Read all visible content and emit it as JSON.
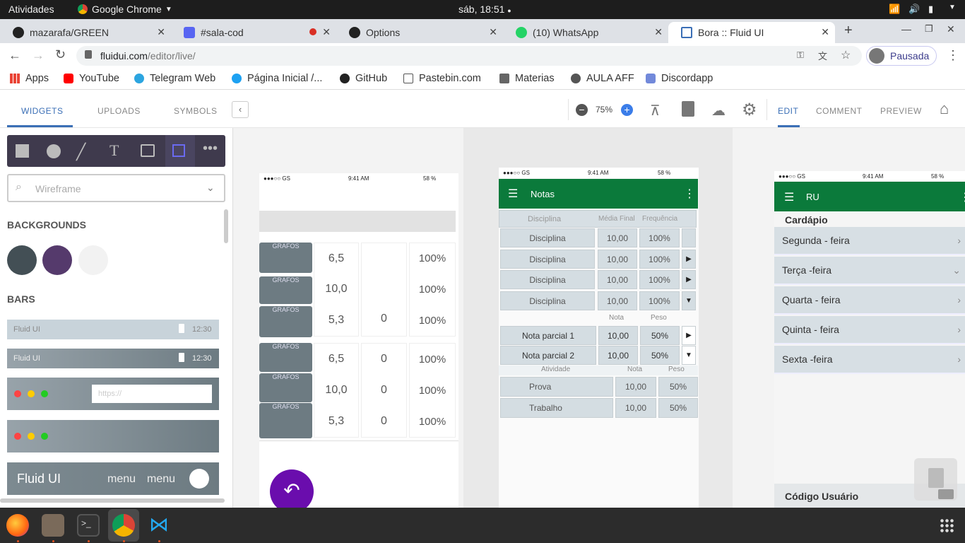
{
  "os": {
    "activities": "Atividades",
    "app_menu": "Google Chrome",
    "clock": "sáb, 18:51"
  },
  "browser": {
    "tabs": [
      {
        "title": "mazarafa/GREEN"
      },
      {
        "title": "#sala-cod"
      },
      {
        "title": "Options"
      },
      {
        "title": "(10) WhatsApp"
      },
      {
        "title": "Bora :: Fluid UI"
      }
    ],
    "new_tab": "+",
    "url_host": "fluidui.com",
    "url_path": "/editor/live/",
    "profile_label": "Pausada",
    "bookmarks": [
      "Apps",
      "YouTube",
      "Telegram Web",
      "Página Inicial /...",
      "GitHub",
      "Pastebin.com",
      "Materias",
      "AULA AFF",
      "Discordapp"
    ]
  },
  "app": {
    "left_tabs": [
      "WIDGETS",
      "UPLOADS",
      "SYMBOLS"
    ],
    "zoom": "75%",
    "mode_tabs": [
      "EDIT",
      "COMMENT",
      "PREVIEW"
    ],
    "search_placeholder": "Wireframe",
    "section_backgrounds": "BACKGROUNDS",
    "section_bars": "BARS",
    "bar1_label": "Fluid UI",
    "bar1_time": "12:30",
    "bar2_label": "Fluid UI",
    "bar2_time": "12:30",
    "url_placeholder": "https://",
    "fluid_title": "Fluid UI",
    "fluid_menu1": "menu",
    "fluid_menu2": "menu",
    "colors": {
      "swatch1": "#434f55",
      "swatch2": "#553a6c",
      "swatch3": "#f2f2f2",
      "accent": "#3b6fb6",
      "green": "#0b7a3b",
      "purple": "#6a0dad"
    }
  },
  "phone1": {
    "status": {
      "carrier": "●●●○○ GS",
      "time": "9:41 AM",
      "battery": "58 %"
    },
    "btn_label": "GRAFOS",
    "grid1": {
      "v1": "6,5",
      "v2": "10,0",
      "v3": "5,3",
      "z": "0",
      "p1": "100%",
      "p2": "100%",
      "p3": "100%"
    },
    "grid2": {
      "v1": "6,5",
      "v2": "10,0",
      "v3": "5,3",
      "z1": "0",
      "z2": "0",
      "z3": "0",
      "p1": "100%",
      "p2": "100%",
      "p3": "100%"
    }
  },
  "phone2": {
    "status": {
      "carrier": "●●●○○ GS",
      "time": "9:41 AM",
      "battery": "58 %"
    },
    "title": "Notas",
    "head": {
      "col1": "Disciplina",
      "col2": "Média Final",
      "col3": "Frequência"
    },
    "rows": [
      {
        "name": "Disciplina",
        "grade": "10,00",
        "freq": "100%"
      },
      {
        "name": "Disciplina",
        "grade": "10,00",
        "freq": "100%"
      },
      {
        "name": "Disciplina",
        "grade": "10,00",
        "freq": "100%"
      },
      {
        "name": "Disciplina",
        "grade": "10,00",
        "freq": "100%"
      }
    ],
    "sub_head": {
      "nota": "Nota",
      "peso": "Peso"
    },
    "partials": [
      {
        "name": "Nota parcial 1",
        "grade": "10,00",
        "weight": "50%"
      },
      {
        "name": "Nota parcial 2",
        "grade": "10,00",
        "weight": "50%"
      }
    ],
    "act_head": {
      "atividade": "Atividade",
      "nota": "Nota",
      "peso": "Peso"
    },
    "activities": [
      {
        "name": "Prova",
        "grade": "10,00",
        "weight": "50%"
      },
      {
        "name": "Trabalho",
        "grade": "10,00",
        "weight": "50%"
      }
    ]
  },
  "phone3": {
    "status": {
      "carrier": "●●●○○ GS",
      "time": "9:41 AM",
      "battery": "58 %"
    },
    "title": "RU",
    "section": "Cardápio",
    "days": [
      "Segunda - feira",
      "Terça -feira",
      "Quarta - feira",
      "Quinta - feira",
      "Sexta -feira"
    ],
    "footer": "Código Usuário"
  }
}
